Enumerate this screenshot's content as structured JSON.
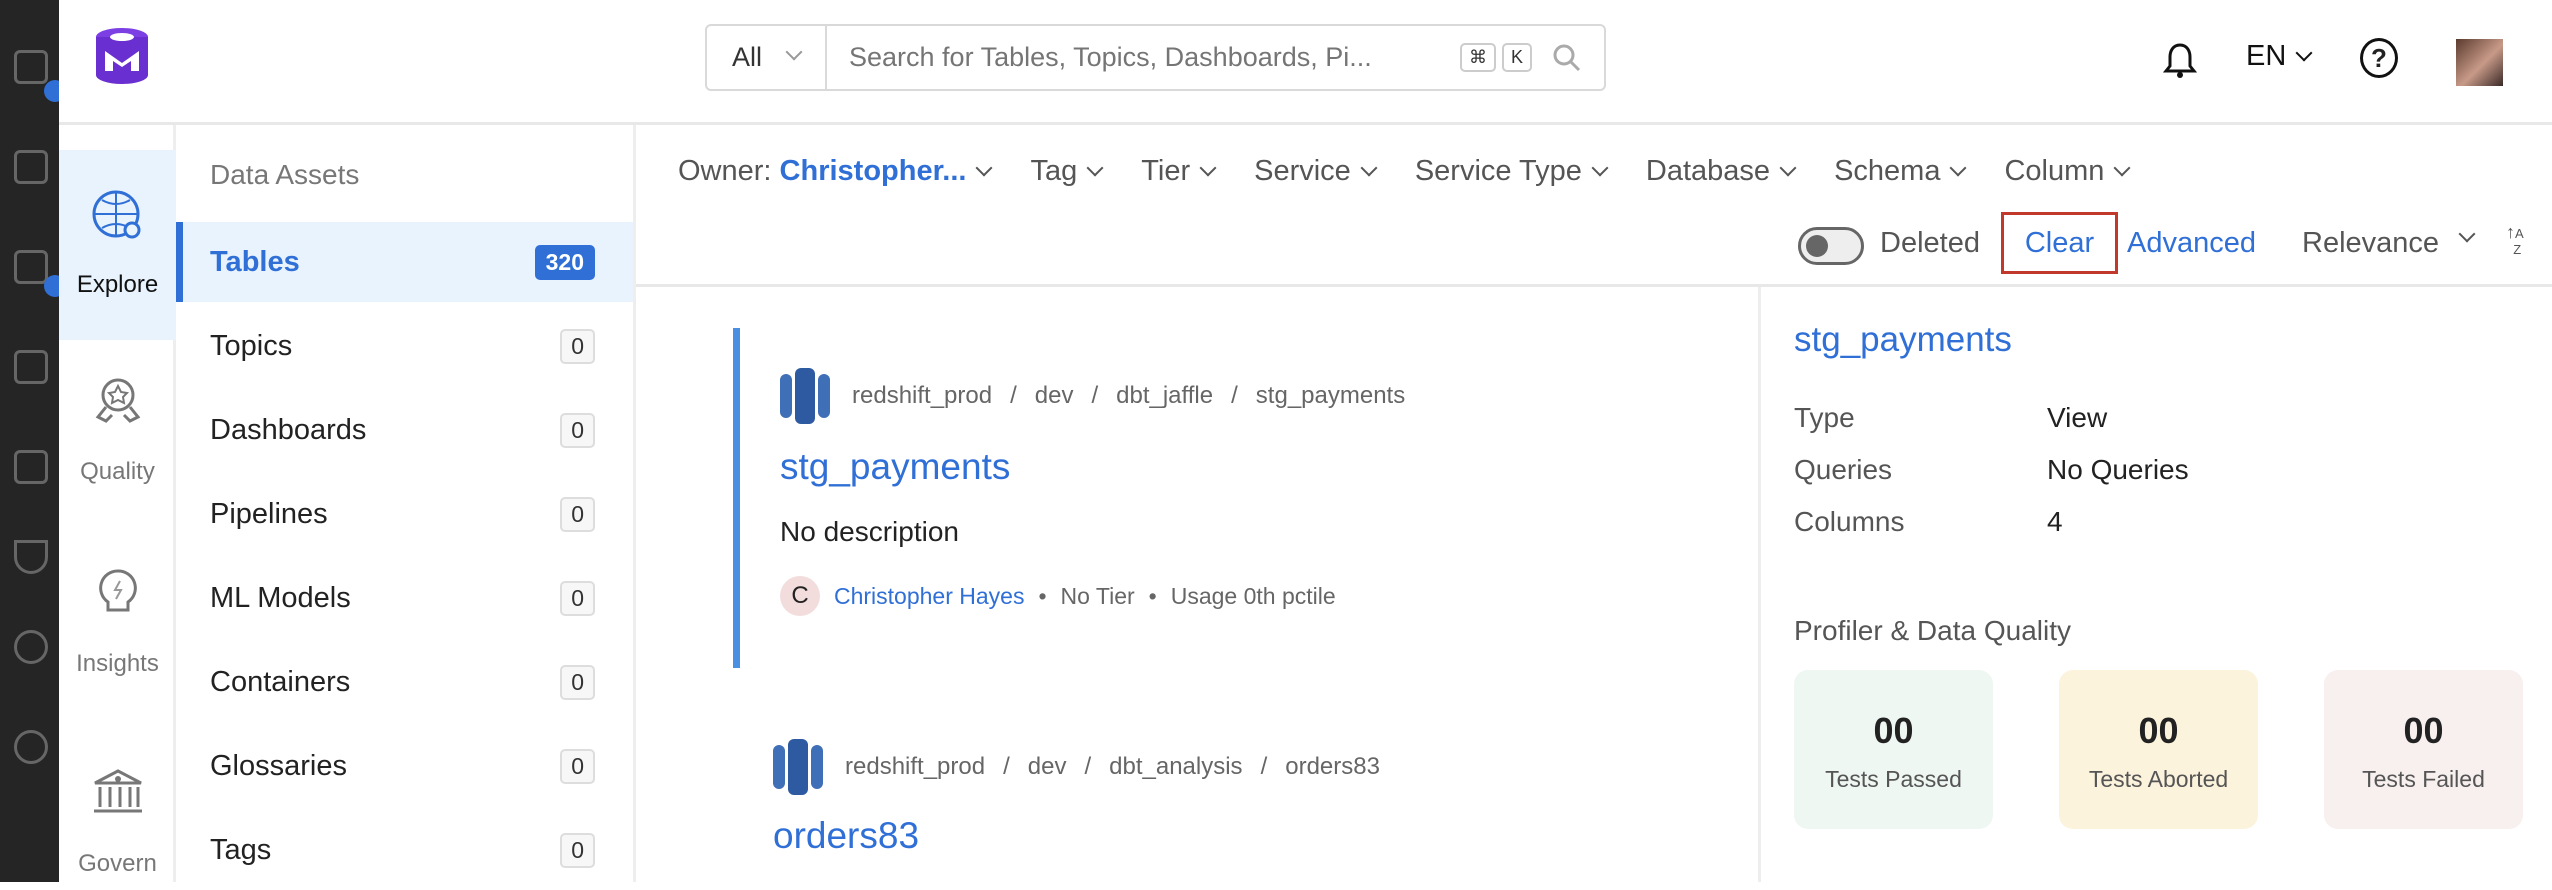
{
  "header": {
    "search_scope": "All",
    "search_placeholder": "Search for Tables, Topics, Dashboards, Pi...",
    "shortcut_cmd": "⌘",
    "shortcut_key": "K",
    "language": "EN"
  },
  "nav": [
    {
      "label": "Explore",
      "icon": "explore-globe-icon",
      "active": true
    },
    {
      "label": "Quality",
      "icon": "quality-badge-icon"
    },
    {
      "label": "Insights",
      "icon": "insights-bulb-icon"
    },
    {
      "label": "Govern",
      "icon": "govern-bank-icon"
    }
  ],
  "assets": {
    "title": "Data Assets",
    "items": [
      {
        "label": "Tables",
        "count": "320",
        "active": true
      },
      {
        "label": "Topics",
        "count": "0"
      },
      {
        "label": "Dashboards",
        "count": "0"
      },
      {
        "label": "Pipelines",
        "count": "0"
      },
      {
        "label": "ML Models",
        "count": "0"
      },
      {
        "label": "Containers",
        "count": "0"
      },
      {
        "label": "Glossaries",
        "count": "0"
      },
      {
        "label": "Tags",
        "count": "0"
      }
    ]
  },
  "filters": {
    "owner_label": "Owner:",
    "owner_value": "Christopher...",
    "items": [
      "Tag",
      "Tier",
      "Service",
      "Service Type",
      "Database",
      "Schema",
      "Column"
    ],
    "deleted": "Deleted",
    "deleted_on": false,
    "clear": "Clear",
    "advanced": "Advanced",
    "sort": "Relevance"
  },
  "results": [
    {
      "crumbs": [
        "redshift_prod",
        "dev",
        "dbt_jaffle",
        "stg_payments"
      ],
      "title": "stg_payments",
      "description": "No description",
      "owner_initial": "C",
      "owner": "Christopher Hayes",
      "tier": "No Tier",
      "usage": "Usage 0th pctile"
    },
    {
      "crumbs": [
        "redshift_prod",
        "dev",
        "dbt_analysis",
        "orders83"
      ],
      "title": "orders83"
    }
  ],
  "detail": {
    "title": "stg_payments",
    "rows": [
      {
        "k": "Type",
        "v": "View"
      },
      {
        "k": "Queries",
        "v": "No Queries"
      },
      {
        "k": "Columns",
        "v": "4"
      }
    ],
    "profiler_title": "Profiler & Data Quality",
    "tests": [
      {
        "n": "00",
        "l": "Tests Passed",
        "bg": "#eef7f2"
      },
      {
        "n": "00",
        "l": "Tests Aborted",
        "bg": "#fbf3dc"
      },
      {
        "n": "00",
        "l": "Tests Failed",
        "bg": "#f8efef"
      }
    ]
  },
  "colors": {
    "accent": "#2f6fd6",
    "clear_outline": "#c0392b"
  }
}
